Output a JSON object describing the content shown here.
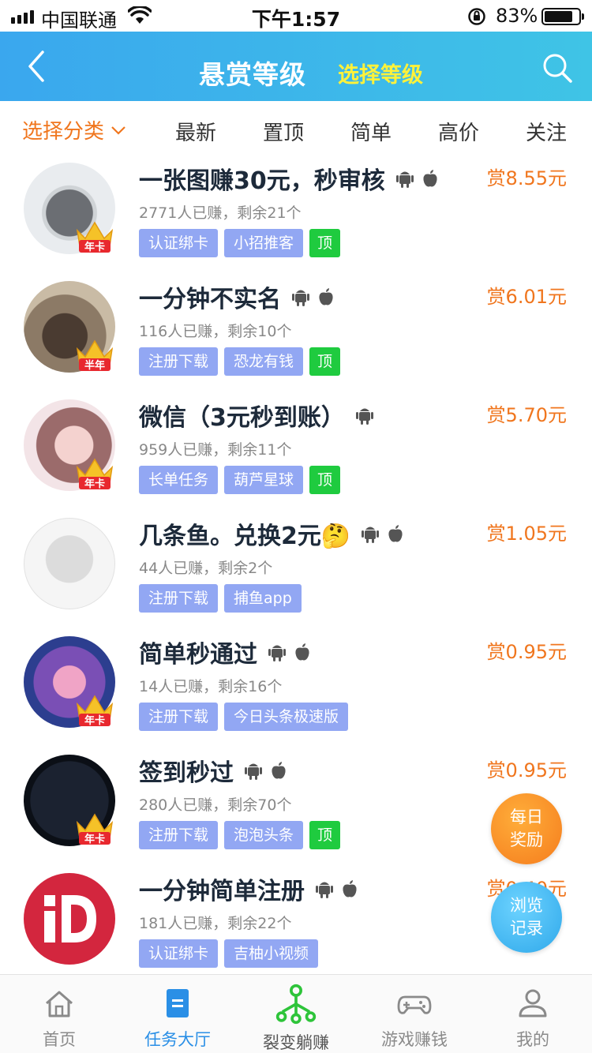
{
  "status_bar": {
    "carrier": "中国联通",
    "time": "下午1:57",
    "battery_pct": "83%",
    "battery_level": 0.83
  },
  "header": {
    "title": "悬赏等级",
    "select_level": "选择等级"
  },
  "filters": {
    "category": "选择分类",
    "tabs": [
      "最新",
      "置顶",
      "简单",
      "高价",
      "关注"
    ]
  },
  "tasks": [
    {
      "title": "一张图赚30元，秒审核",
      "reward": "赏8.55元",
      "meta": "2771人已赚，剩余21个",
      "tags": [
        "认证绑卡",
        "小招推客"
      ],
      "top": "顶",
      "badge": "年卡",
      "android": true,
      "apple": true
    },
    {
      "title": "一分钟不实名",
      "reward": "赏6.01元",
      "meta": "116人已赚，剩余10个",
      "tags": [
        "注册下载",
        "恐龙有钱"
      ],
      "top": "顶",
      "badge": "半年",
      "android": true,
      "apple": true
    },
    {
      "title": "微信（3元秒到账）",
      "reward": "赏5.70元",
      "meta": "959人已赚，剩余11个",
      "tags": [
        "长单任务",
        "葫芦星球"
      ],
      "top": "顶",
      "badge": "年卡",
      "android": true,
      "apple": false
    },
    {
      "title": "几条鱼。兑换2元🤔",
      "reward": "赏1.05元",
      "meta": "44人已赚，剩余2个",
      "tags": [
        "注册下载",
        "捕鱼app"
      ],
      "top": "",
      "badge": "",
      "android": true,
      "apple": true
    },
    {
      "title": "简单秒通过",
      "reward": "赏0.95元",
      "meta": "14人已赚，剩余16个",
      "tags": [
        "注册下载",
        "今日头条极速版"
      ],
      "top": "",
      "badge": "年卡",
      "android": true,
      "apple": true
    },
    {
      "title": "签到秒过",
      "reward": "赏0.95元",
      "meta": "280人已赚，剩余70个",
      "tags": [
        "注册下载",
        "泡泡头条"
      ],
      "top": "顶",
      "badge": "年卡",
      "android": true,
      "apple": true
    },
    {
      "title": "一分钟简单注册",
      "reward": "赏0.40元",
      "meta": "181人已赚，剩余22个",
      "tags": [
        "认证绑卡",
        "吉柚小视频"
      ],
      "top": "",
      "badge": "",
      "android": true,
      "apple": true
    }
  ],
  "floating": {
    "daily_line1": "每日",
    "daily_line2": "奖励",
    "history_line1": "浏览",
    "history_line2": "记录"
  },
  "tabbar": {
    "items": [
      {
        "label": "首页",
        "icon": "home-icon"
      },
      {
        "label": "任务大厅",
        "icon": "task-hall-icon"
      },
      {
        "label": "裂变躺赚",
        "icon": "fission-icon"
      },
      {
        "label": "游戏赚钱",
        "icon": "gamepad-icon"
      },
      {
        "label": "我的",
        "icon": "user-icon"
      }
    ],
    "active_index": 1
  },
  "colors": {
    "header_start": "#3aa7ee",
    "header_end": "#3fc4e6",
    "accent_orange": "#f0761e",
    "tag_blue": "#92a7f3",
    "tag_green": "#1fcb3f",
    "tab_active": "#2a8fe6"
  }
}
